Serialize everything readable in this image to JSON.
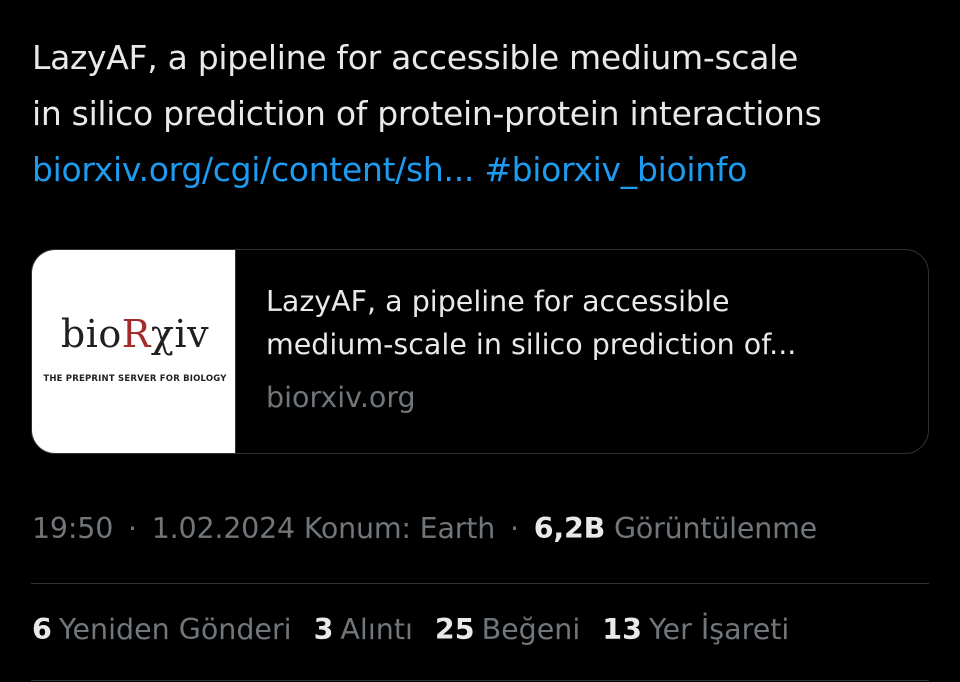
{
  "tweet": {
    "text_line1": "LazyAF, a pipeline for accessible medium-scale",
    "text_line2": "in silico prediction of protein-protein interactions",
    "link_text": "biorxiv.org/cgi/content/sh...",
    "hashtag": "#biorxiv_bioinfo"
  },
  "card": {
    "logo": {
      "pre": "bio",
      "r": "R",
      "post": "χiv",
      "tagline": "THE PREPRINT SERVER FOR BIOLOGY"
    },
    "title_line1": "LazyAF, a pipeline for accessible",
    "title_line2": "medium-scale in silico prediction of...",
    "domain": "biorxiv.org"
  },
  "meta": {
    "time": "19:50",
    "date": "1.02.2024",
    "location": "Konum: Earth",
    "views_count": "6,2B",
    "views_label": "Görüntülenme",
    "separator": "·"
  },
  "stats": [
    {
      "count": "6",
      "label": "Yeniden Gönderi"
    },
    {
      "count": "3",
      "label": "Alıntı"
    },
    {
      "count": "25",
      "label": "Beğeni"
    },
    {
      "count": "13",
      "label": "Yer İşareti"
    }
  ],
  "colors": {
    "background": "#000000",
    "text": "#e7e9ea",
    "link": "#1d9bf0",
    "muted": "#71767b",
    "border": "#2f3336"
  }
}
